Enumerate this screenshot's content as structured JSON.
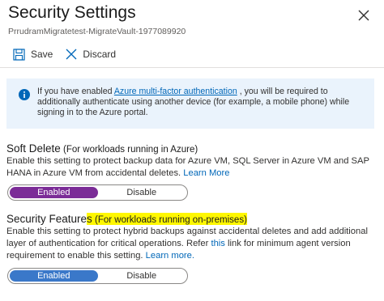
{
  "header": {
    "title": "Security Settings",
    "subtitle": "PrrudramMigratetest-MigrateVault-1977089920"
  },
  "toolbar": {
    "save_label": "Save",
    "discard_label": "Discard"
  },
  "info": {
    "text_before_link": "If you have enabled ",
    "link_text": "Azure multi-factor authentication",
    "text_after_link": " , you will be required to additionally authenticate using another device (for example, a mobile phone) while signing in to the Azure portal."
  },
  "soft_delete": {
    "heading": "Soft Delete",
    "subheading": " (For workloads running in Azure)",
    "description": "Enable this setting to protect backup data for Azure VM, SQL Server in Azure VM and SAP HANA in Azure VM from accidental deletes. ",
    "learn_more": "Learn More",
    "options": [
      "Enabled",
      "Disable"
    ],
    "selected": "Enabled"
  },
  "security_features": {
    "heading_part1": "Security Feature",
    "heading_part2": "s",
    "subheading": " (For workloads running on-premises)",
    "description_before_link": "Enable this setting to protect hybrid backups against accidental deletes and add additional layer of authentication for critical operations. Refer ",
    "this_link": "this",
    "description_after_link": " link for minimum agent version requirement to enable this setting. ",
    "learn_more": "Learn more.",
    "options": [
      "Enabled",
      "Disable"
    ],
    "selected": "Enabled"
  },
  "colors": {
    "soft_delete_enabled": "#7b2c97",
    "security_enabled": "#3a78c9",
    "info_background": "#eaf3fc",
    "link": "#0067b8",
    "highlight": "#fff700"
  }
}
